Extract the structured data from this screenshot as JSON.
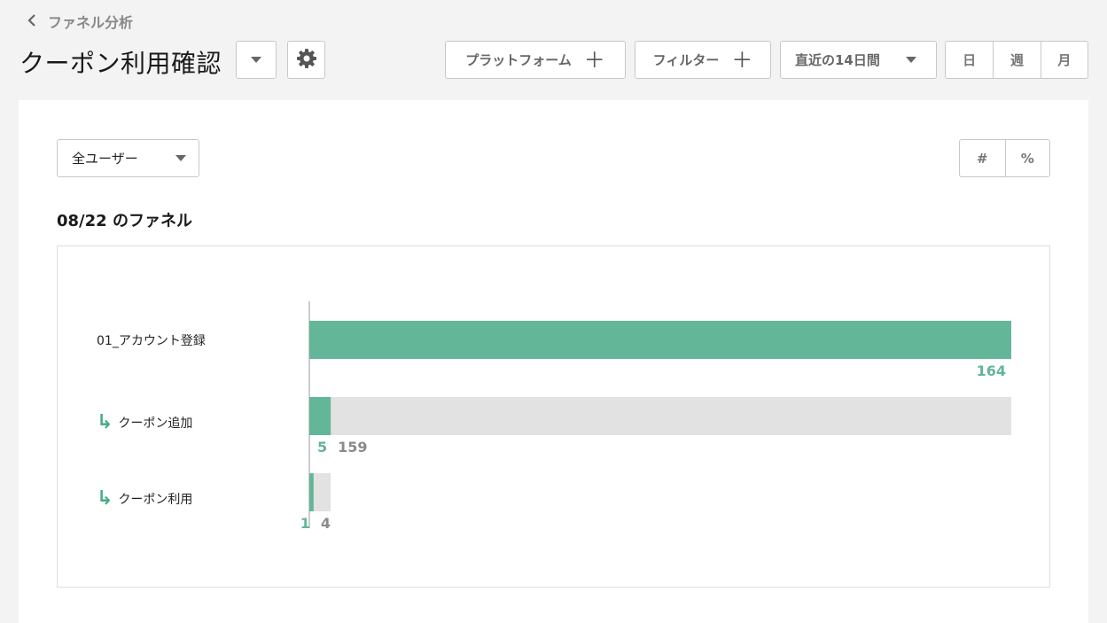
{
  "nav": {
    "back_label": "ファネル分析"
  },
  "header": {
    "title": "クーポン利用確認",
    "platform_label": "プラットフォーム",
    "filter_label": "フィルター",
    "date_range": "直近の14日間",
    "granularity": [
      {
        "label": "日",
        "active": true
      },
      {
        "label": "週",
        "active": false
      },
      {
        "label": "月",
        "active": false
      }
    ]
  },
  "panel": {
    "segment_select": "全ユーザー",
    "display_mode": [
      {
        "label": "#",
        "active": true
      },
      {
        "label": "%",
        "active": false
      }
    ],
    "subtitle": "08/22 のファネル"
  },
  "chart_data": {
    "type": "bar",
    "orientation": "horizontal-funnel",
    "categories": [
      "01_アカウント登録",
      "クーポン追加",
      "クーポン利用"
    ],
    "series": [
      {
        "values": [
          164,
          5,
          1
        ]
      },
      {
        "values": [
          0,
          159,
          4
        ]
      }
    ],
    "colors": {
      "converted": "#63b697",
      "dropped": "#e2e2e2"
    },
    "xlim": [
      0,
      164
    ]
  }
}
